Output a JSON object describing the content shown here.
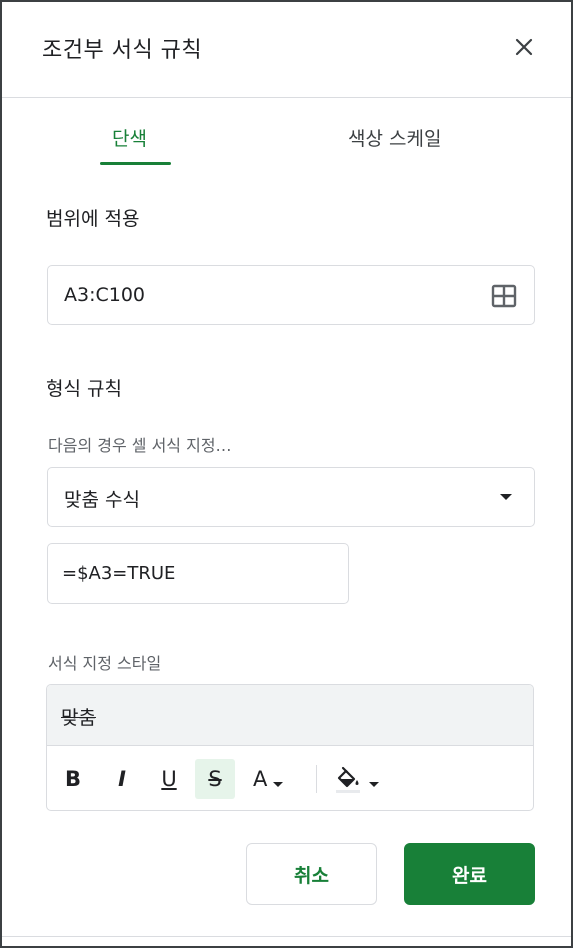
{
  "dialog": {
    "title": "조건부 서식 규칙",
    "close_icon": "close-icon"
  },
  "tabs": [
    {
      "label": "단색",
      "active": true
    },
    {
      "label": "색상 스케일",
      "active": false
    }
  ],
  "range": {
    "section_label": "범위에 적용",
    "value": "A3:C100",
    "icon": "grid-select-icon"
  },
  "format_rules": {
    "section_label": "형식 규칙",
    "condition_label": "다음의 경우 셀 서식 지정…",
    "condition_value": "맞춤 수식",
    "formula_value": "=$A3=TRUE"
  },
  "formatting_style": {
    "label": "서식 지정 스타일",
    "preview_text": "맞춤",
    "toolbar": {
      "bold": "B",
      "italic": "I",
      "underline": "U",
      "strikethrough": "S",
      "text_color": "A",
      "fill_color_icon": "paint-bucket-icon"
    },
    "strikethrough_active": true
  },
  "buttons": {
    "cancel": "취소",
    "done": "완료"
  },
  "colors": {
    "accent": "#188038",
    "border": "#dadce0",
    "preview_bg": "#f1f3f4",
    "active_toggle_bg": "#e6f4ea"
  }
}
